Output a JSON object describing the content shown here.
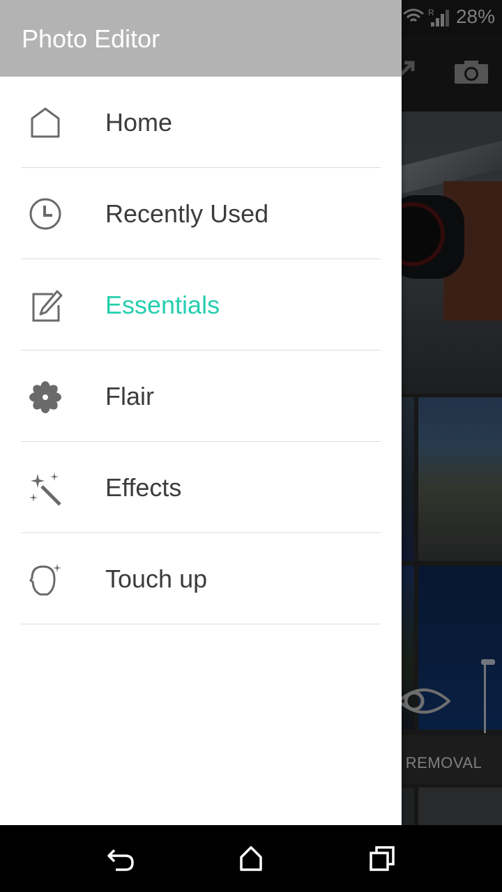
{
  "status_bar": {
    "battery": "28%"
  },
  "drawer": {
    "title": "Photo Editor",
    "items": [
      {
        "label": "Home",
        "icon": "home-icon",
        "active": false
      },
      {
        "label": "Recently Used",
        "icon": "clock-icon",
        "active": false
      },
      {
        "label": "Essentials",
        "icon": "edit-icon",
        "active": true
      },
      {
        "label": "Flair",
        "icon": "flower-icon",
        "active": false
      },
      {
        "label": "Effects",
        "icon": "magic-wand-icon",
        "active": false
      },
      {
        "label": "Touch up",
        "icon": "face-icon",
        "active": false
      }
    ],
    "active_color": "#25cfae"
  },
  "background": {
    "tile_label": "E REMOVAL"
  },
  "navbar": {
    "buttons": [
      "back-icon",
      "home-icon",
      "recents-icon"
    ]
  }
}
